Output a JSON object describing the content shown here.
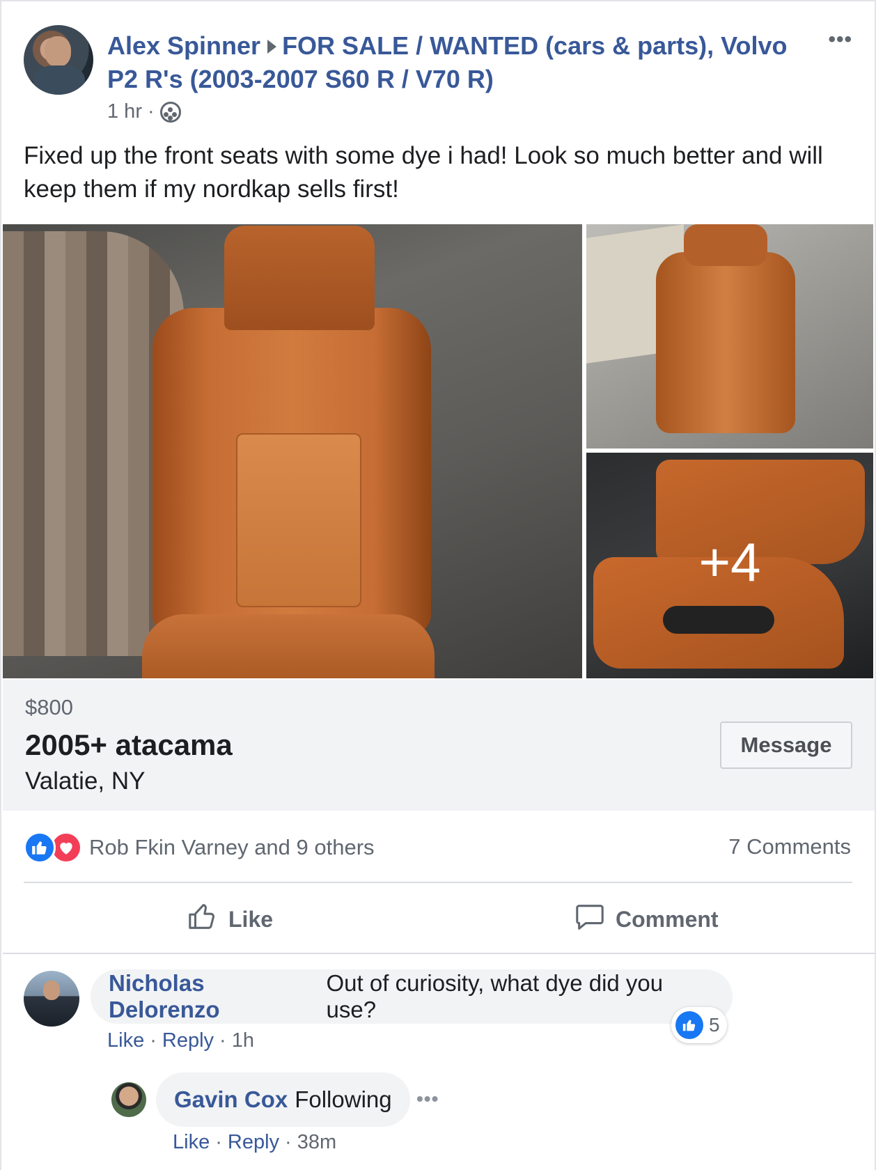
{
  "post": {
    "author": "Alex Spinner",
    "group": "FOR SALE / WANTED (cars & parts), Volvo P2 R's (2003-2007 S60 R / V70 R)",
    "time": "1 hr",
    "separator": "·",
    "text": "Fixed up the front seats with some dye i had! Look so much better and will keep them if my nordkap sells first!",
    "more_photos": "+4"
  },
  "listing": {
    "price": "$800",
    "title": "2005+ atacama",
    "location": "Valatie, NY",
    "message_button": "Message"
  },
  "engagement": {
    "reactors": "Rob Fkin Varney and 9 others",
    "comments_count": "7 Comments",
    "like_label": "Like",
    "comment_label": "Comment"
  },
  "comments": [
    {
      "name": "Nicholas Delorenzo",
      "text": "Out of curiosity, what dye did you use?",
      "like": "Like",
      "reply": "Reply",
      "time": "1h",
      "reaction_count": "5"
    },
    {
      "name": "Gavin Cox",
      "text": "Following",
      "like": "Like",
      "reply": "Reply",
      "time": "38m"
    }
  ],
  "icons": {
    "more": "more-icon",
    "audience": "group-audience-icon",
    "like_reaction": "like-reaction-icon",
    "love_reaction": "love-reaction-icon",
    "thumbs_up": "thumbs-up-icon",
    "comment": "comment-bubble-icon"
  },
  "colors": {
    "link_blue": "#385898",
    "like_blue": "#1877f2",
    "love_red": "#f33e58",
    "secondary_text": "#606770",
    "panel_gray": "#f2f3f5"
  }
}
